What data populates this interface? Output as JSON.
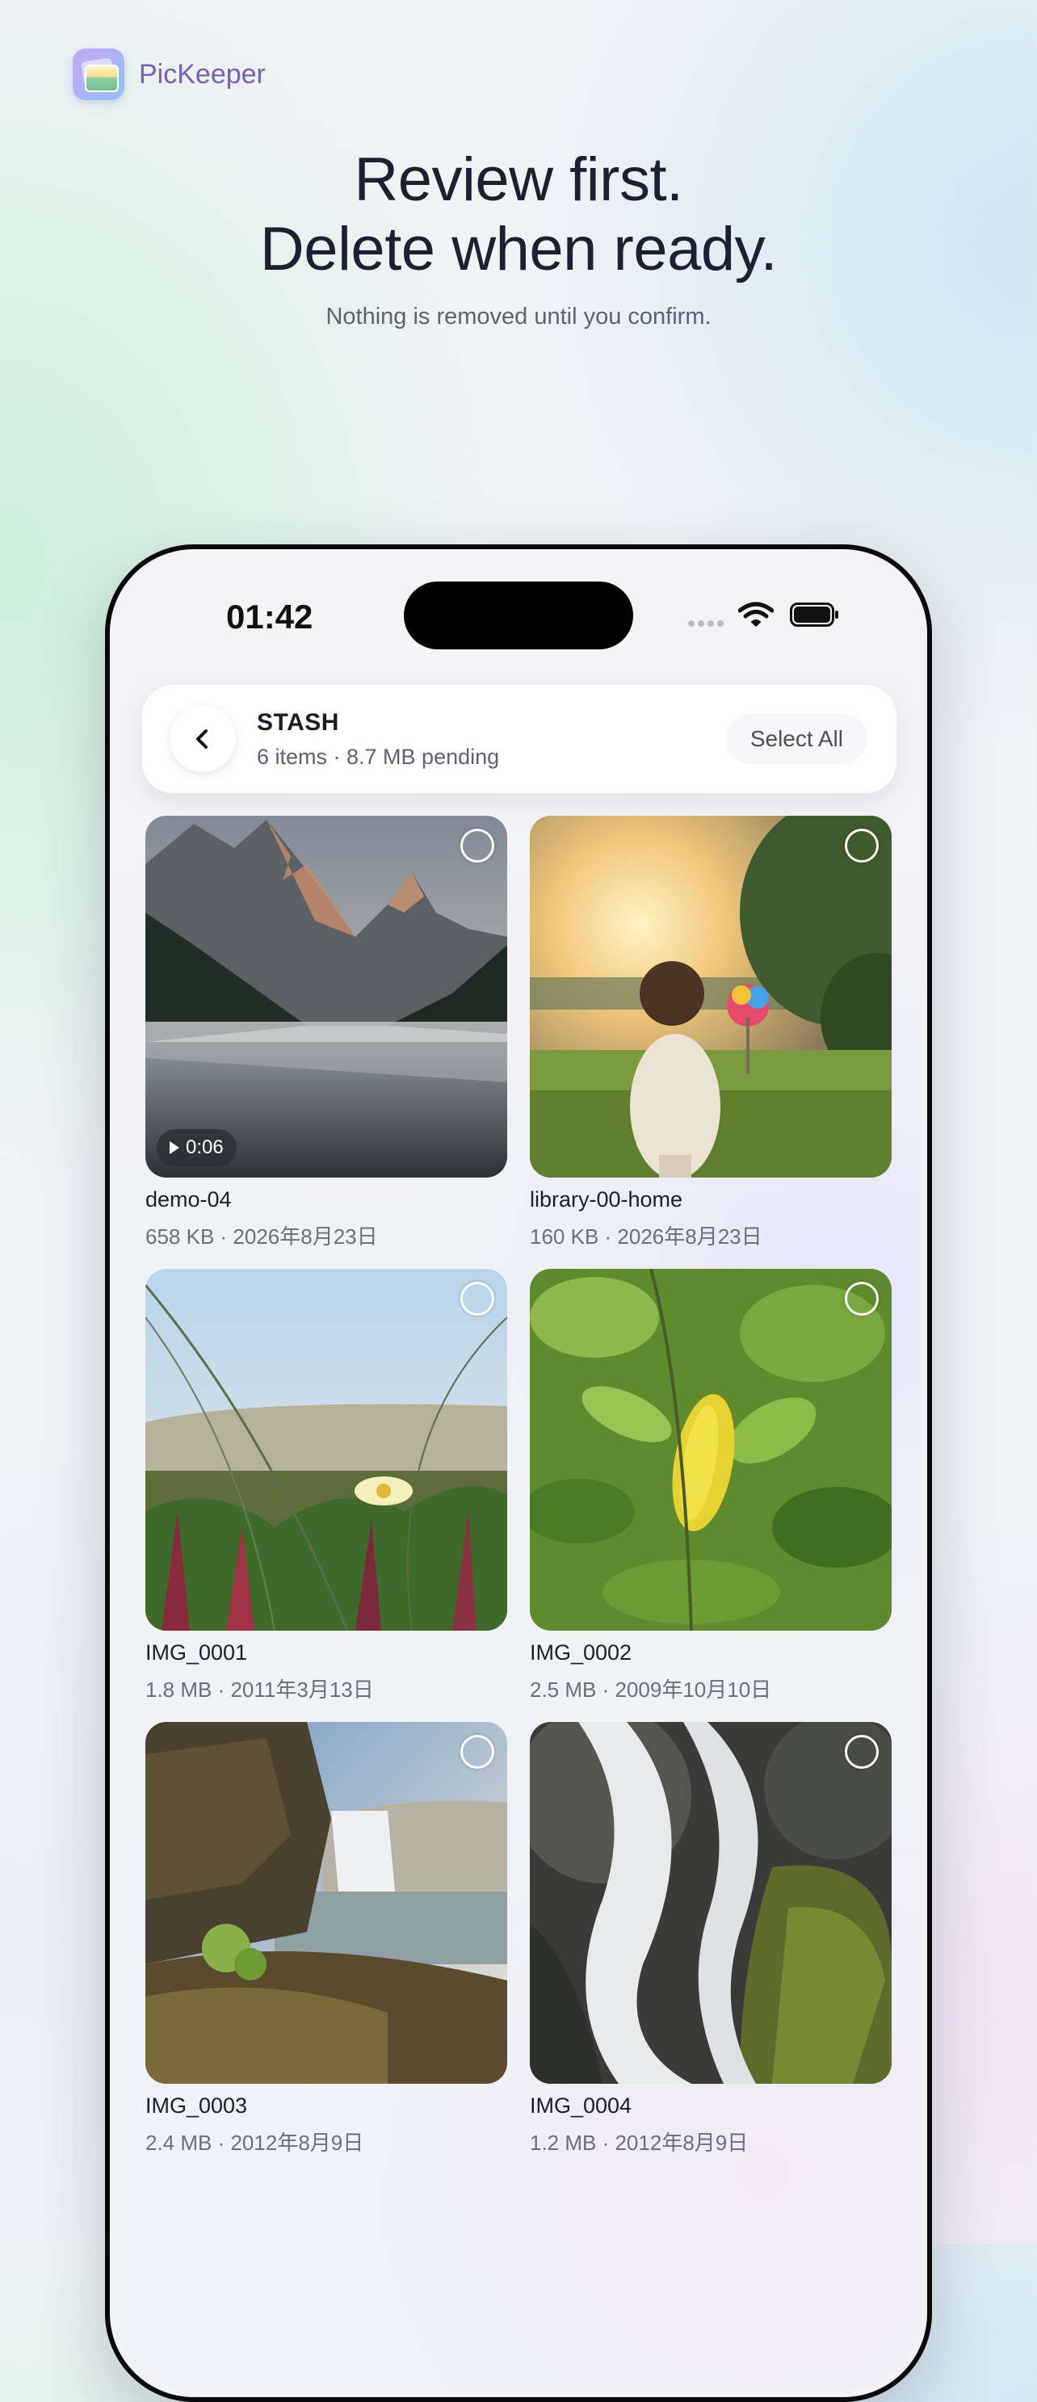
{
  "brand": {
    "name": "PicKeeper",
    "icon": "app-icon"
  },
  "hero": {
    "line1": "Review first.",
    "line2": "Delete when ready.",
    "subtitle": "Nothing is removed until you confirm."
  },
  "status_bar": {
    "time": "01:42",
    "wifi_icon": "wifi-icon",
    "battery_icon": "battery-icon"
  },
  "header": {
    "title": "STASH",
    "subtitle": "6 items · 8.7 MB pending",
    "select_all_label": "Select All",
    "back_icon": "chevron-left-icon"
  },
  "items": [
    {
      "name": "demo-04",
      "meta": "658 KB · 2026年8月23日",
      "duration": "0:06",
      "is_video": true,
      "selected": false
    },
    {
      "name": "library-00-home",
      "meta": "160 KB · 2026年8月23日",
      "selected": false
    },
    {
      "name": "IMG_0001",
      "meta": "1.8 MB · 2011年3月13日",
      "selected": false
    },
    {
      "name": "IMG_0002",
      "meta": "2.5 MB · 2009年10月10日",
      "selected": false
    },
    {
      "name": "IMG_0003",
      "meta": "2.4 MB · 2012年8月9日",
      "selected": false
    },
    {
      "name": "IMG_0004",
      "meta": "1.2 MB · 2012年8月9日",
      "selected": false
    }
  ]
}
